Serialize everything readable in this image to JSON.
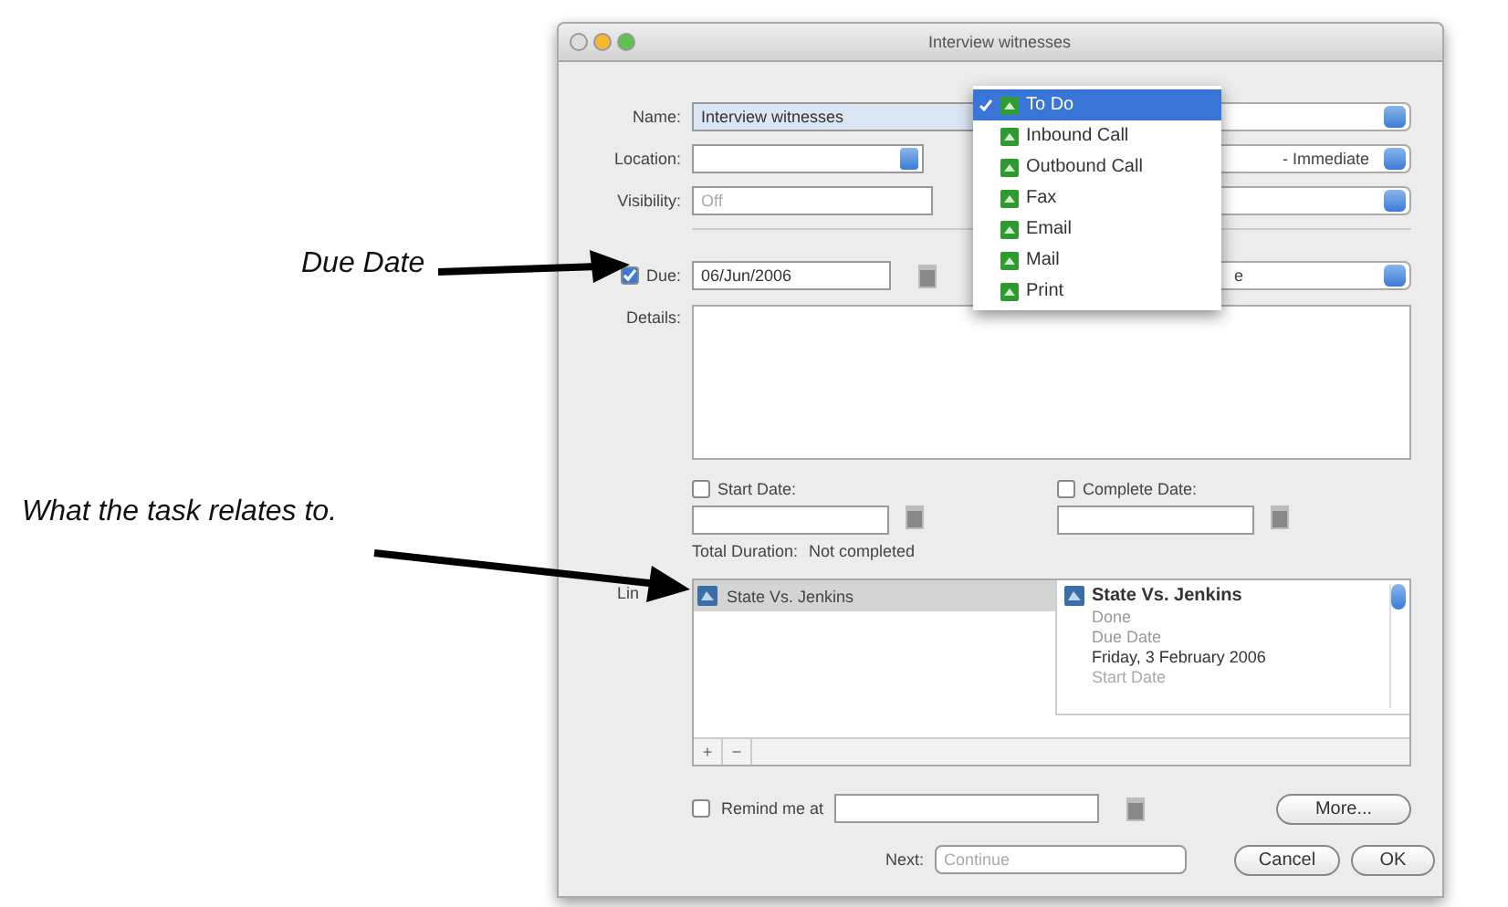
{
  "window": {
    "title": "Interview witnesses"
  },
  "form": {
    "name_label": "Name:",
    "name_value": "Interview witnesses",
    "location_label": "Location:",
    "visibility_label": "Visibility:",
    "visibility_value": "Off",
    "due": {
      "label": "Due:",
      "checked": true,
      "value": "06/Jun/2006"
    },
    "details_label": "Details:"
  },
  "priority_popup": {
    "value": "- Immediate"
  },
  "due_popup": {
    "value": "e"
  },
  "type_menu": [
    {
      "label": "To Do",
      "selected": true
    },
    {
      "label": "Inbound Call",
      "selected": false
    },
    {
      "label": "Outbound Call",
      "selected": false
    },
    {
      "label": "Fax",
      "selected": false
    },
    {
      "label": "Email",
      "selected": false
    },
    {
      "label": "Mail",
      "selected": false
    },
    {
      "label": "Print",
      "selected": false
    }
  ],
  "start_date": {
    "label": "Start Date:",
    "checked": false
  },
  "complete_date": {
    "label": "Complete Date:",
    "checked": false
  },
  "total_duration": {
    "label": "Total Duration:",
    "value": "Not completed"
  },
  "links": {
    "label": "Lin",
    "items": [
      {
        "label": "State Vs. Jenkins",
        "selected": true
      }
    ],
    "detail": {
      "title": "State Vs. Jenkins",
      "status": "Done",
      "due_label": "Due Date",
      "due_value": "Friday, 3 February 2006",
      "start_label": "Start Date"
    },
    "add": "+",
    "remove": "−"
  },
  "reminder": {
    "label": "Remind me at",
    "checked": false
  },
  "next": {
    "label": "Next:",
    "value": "Continue"
  },
  "buttons": {
    "more": "More...",
    "cancel": "Cancel",
    "ok": "OK"
  },
  "annotations": [
    {
      "text": "Due Date"
    },
    {
      "text": "What the task relates to."
    }
  ]
}
